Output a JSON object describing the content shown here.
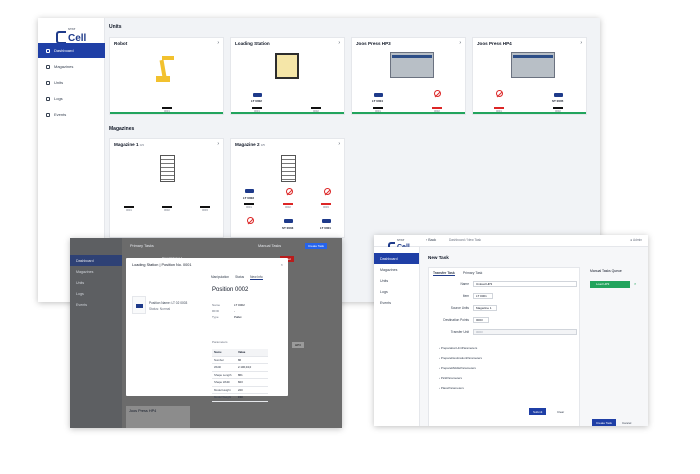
{
  "main": {
    "logo": {
      "top": "STAT",
      "name": "Cell"
    },
    "nav": [
      "Dashboard",
      "Magazines",
      "Units",
      "Logs",
      "Events"
    ],
    "units_title": "Units",
    "magazines_title": "Magazines",
    "units": [
      {
        "title": "Robot",
        "slots": [
          "0001"
        ]
      },
      {
        "title": "Loading Station",
        "tray": "LT 0002",
        "slots": [
          "0001",
          "0002"
        ]
      },
      {
        "title": "Joos Press HP3",
        "tray": "LT 0004",
        "slots": [
          "0001",
          "0002"
        ]
      },
      {
        "title": "Joos Press HP4",
        "tray": "ST 0005",
        "slots": [
          "0001",
          "0002"
        ]
      }
    ],
    "magazines": [
      {
        "title": "Magazine 1",
        "count": "0/3",
        "slots": [
          "0001",
          "0002",
          "0003"
        ]
      },
      {
        "title": "Magazine 2",
        "count": "3/5",
        "trays": [
          "LT 0003",
          "ST 0003",
          "LT 0001"
        ],
        "slots": [
          "0001",
          "0002",
          "0003"
        ]
      }
    ]
  },
  "dialog": {
    "nav": [
      "Dashboard",
      "Magazines",
      "Units",
      "Logs",
      "Events"
    ],
    "header": {
      "primary": "Primary Tasks",
      "manual": "Manual Tasks",
      "create": "Create Task",
      "partial": "Drag Roboter 1",
      "danger": "Reset"
    },
    "modal": {
      "title": "Loading Station | Position No. 0001",
      "close": "×",
      "position_name": "Position Name: LT 02 0003",
      "status": "Status: Normal",
      "tabs": [
        "Manipulation",
        "Status",
        "New Info"
      ],
      "position": "Position 0002",
      "fields": [
        {
          "k": "Name",
          "v": "LT 0002"
        },
        {
          "k": "RFID",
          "v": "-"
        },
        {
          "k": "Type",
          "v": "Pallet"
        }
      ],
      "params_label": "Parameters",
      "params_head": {
        "k": "Name",
        "v": "Value"
      },
      "params": [
        {
          "k": "Number",
          "v": "86"
        },
        {
          "k": "Width",
          "v": "2.100,04,0"
        },
        {
          "k": "Shape Length",
          "v": "861"
        },
        {
          "k": "Shape Width",
          "v": "823"
        },
        {
          "k": "Model Height",
          "v": "220"
        },
        {
          "k": "Model Weight",
          "v": "150"
        }
      ]
    },
    "bottom_card": "Joos Press HP4",
    "peek": "HP3"
  },
  "task": {
    "logo": {
      "top": "STAT",
      "name": "Cell"
    },
    "back": "Back",
    "crumbs": "Dashboard  /  New Task",
    "user": "Admin",
    "nav": [
      "Dashboard",
      "Magazines",
      "Units",
      "Logs",
      "Events"
    ],
    "heading": "New Task",
    "tabs": [
      "Transfer Task",
      "Primary Task"
    ],
    "form": {
      "name_label": "Name",
      "name_value": "Unload HP3",
      "item_label": "Item",
      "item_value": "LT 0001",
      "source_label": "Source Units",
      "source_value": "Magazine 1",
      "dest_label": "Destination Points",
      "dest_value": "0003",
      "transfer_label": "Transfer Unit",
      "transfer_value": "0003"
    },
    "accordions": [
      "PreparationUnitParameters",
      "PrepareDestinationParameters",
      "PrepareMiddleParameters",
      "PickParameters",
      "PlaceParameters"
    ],
    "submit": "Submit",
    "clear": "Clear",
    "queue_title": "Manual Tasks Queue",
    "queue_item": "Load HP3",
    "create": "Create Task",
    "cancel": "Cancel"
  }
}
